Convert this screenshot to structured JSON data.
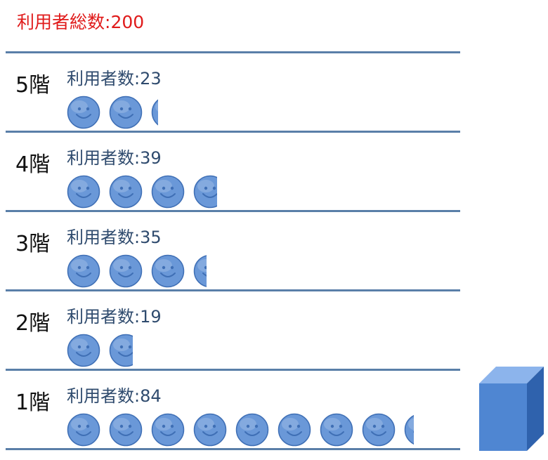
{
  "summary": {
    "label": "利用者総数",
    "separator": ":",
    "total": "200"
  },
  "colors": {
    "total_text": "#e01b1b",
    "floor_line": "#5a7fa8",
    "count_text": "#2f4b6e",
    "icon_fill": "#6a98d8",
    "icon_dark": "#3f6fb5",
    "cube_front": "#4f86d2",
    "cube_top": "#8cb4ec",
    "cube_side": "#2f62ad"
  },
  "icons": {
    "person": "smiley-face-icon",
    "building": "cube-icon"
  },
  "floors": [
    {
      "label": "5階",
      "count_label": "利用者数",
      "separator": ":",
      "count": 23,
      "icons_shown": 2.2
    },
    {
      "label": "4階",
      "count_label": "利用者数",
      "separator": ":",
      "count": 39,
      "icons_shown": 3.7
    },
    {
      "label": "3階",
      "count_label": "利用者数",
      "separator": ":",
      "count": 35,
      "icons_shown": 3.4
    },
    {
      "label": "2階",
      "count_label": "利用者数",
      "separator": ":",
      "count": 19,
      "icons_shown": 1.7
    },
    {
      "label": "1階",
      "count_label": "利用者数",
      "separator": ":",
      "count": 84,
      "icons_shown": 8.3
    }
  ]
}
